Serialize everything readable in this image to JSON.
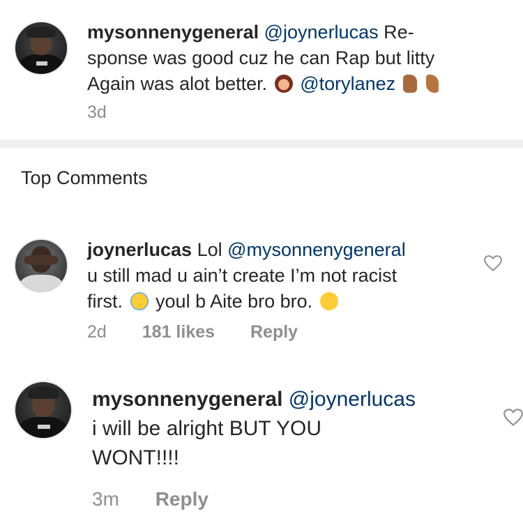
{
  "caption": {
    "username": "mysonnenygeneral",
    "mention1": "@joynerlucas",
    "line1_rest": "Re-",
    "line2": "sponse was good cuz he can Rap but litty",
    "line3_pre": "Again was alot better.",
    "mention2": "@torylanez",
    "time": "3d",
    "emojis": [
      "woman-gesturing-no-icon",
      "thumbs-up-icon",
      "flexed-biceps-icon"
    ]
  },
  "section": {
    "title": "Top Comments"
  },
  "comment1": {
    "username": "joynerlucas",
    "text_pre": "Lol",
    "mention": "@mysonnenygeneral",
    "line2": "u still mad u ain’t create I’m not racist",
    "line3_pre": "first.",
    "line3_mid": "youl b Aite bro bro.",
    "time": "2d",
    "likes": "181 likes",
    "reply": "Reply",
    "emojis": [
      "crying-face-icon",
      "laughing-face-icon"
    ]
  },
  "comment2": {
    "username": "mysonnenygeneral",
    "mention": "@joynerlucas",
    "line2": "i will be alright BUT YOU",
    "line3": "WONT!!!!",
    "time": "3m",
    "reply": "Reply"
  },
  "colors": {
    "text": "#262626",
    "mention": "#003569",
    "meta": "#8e8e8e",
    "divider": "#efefef"
  }
}
